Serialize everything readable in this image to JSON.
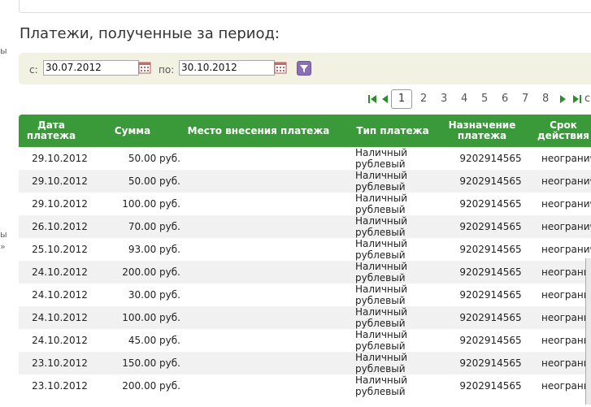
{
  "left_fragments": [
    "ы",
    "ы",
    "»"
  ],
  "page_title": "Платежи, полученные за период:",
  "filter": {
    "from_label": "с:",
    "from_value": "30.07.2012",
    "to_label": "по:",
    "to_value": "30.10.2012"
  },
  "pagination": {
    "pages": [
      "1",
      "2",
      "3",
      "4",
      "5",
      "6",
      "7",
      "8"
    ],
    "current": "1",
    "trailing": "с"
  },
  "table": {
    "headers": {
      "date": "Дата платежа",
      "sum": "Сумма",
      "place": "Место внесения платежа",
      "type": "Тип платежа",
      "purpose": "Назначение платежа",
      "term": "Срок действия"
    },
    "rows": [
      {
        "date": "29.10.2012",
        "sum": "50.00 руб.",
        "type1": "Наличный",
        "type2": "рублевый",
        "purpose": "9202914565",
        "term": "неогранич"
      },
      {
        "date": "29.10.2012",
        "sum": "50.00 руб.",
        "type1": "Наличный",
        "type2": "рублевый",
        "purpose": "9202914565",
        "term": "неогранич"
      },
      {
        "date": "29.10.2012",
        "sum": "100.00 руб.",
        "type1": "Наличный",
        "type2": "рублевый",
        "purpose": "9202914565",
        "term": "неогранич"
      },
      {
        "date": "26.10.2012",
        "sum": "70.00 руб.",
        "type1": "Наличный",
        "type2": "рублевый",
        "purpose": "9202914565",
        "term": "неогранич"
      },
      {
        "date": "25.10.2012",
        "sum": "93.00 руб.",
        "type1": "Наличный",
        "type2": "рублевый",
        "purpose": "9202914565",
        "term": "неогранич"
      },
      {
        "date": "24.10.2012",
        "sum": "200.00 руб.",
        "type1": "Наличный",
        "type2": "рублевый",
        "purpose": "9202914565",
        "term": "неогранич"
      },
      {
        "date": "24.10.2012",
        "sum": "30.00 руб.",
        "type1": "Наличный",
        "type2": "рублевый",
        "purpose": "9202914565",
        "term": "неогранич"
      },
      {
        "date": "24.10.2012",
        "sum": "100.00 руб.",
        "type1": "Наличный",
        "type2": "рублевый",
        "purpose": "9202914565",
        "term": "неогранич"
      },
      {
        "date": "24.10.2012",
        "sum": "45.00 руб.",
        "type1": "Наличный",
        "type2": "рублевый",
        "purpose": "9202914565",
        "term": "неогранич"
      },
      {
        "date": "23.10.2012",
        "sum": "150.00 руб.",
        "type1": "Наличный",
        "type2": "рублевый",
        "purpose": "9202914565",
        "term": "неогранич"
      },
      {
        "date": "23.10.2012",
        "sum": "200.00 руб.",
        "type1": "Наличный",
        "type2": "рублевый",
        "purpose": "9202914565",
        "term": "неогранич"
      }
    ]
  },
  "colors": {
    "header_green": "#3a9a3a",
    "pager_green": "#2e8b2e",
    "filter_bg": "#f2f2e2",
    "filter_button": "#8a6fb8"
  }
}
